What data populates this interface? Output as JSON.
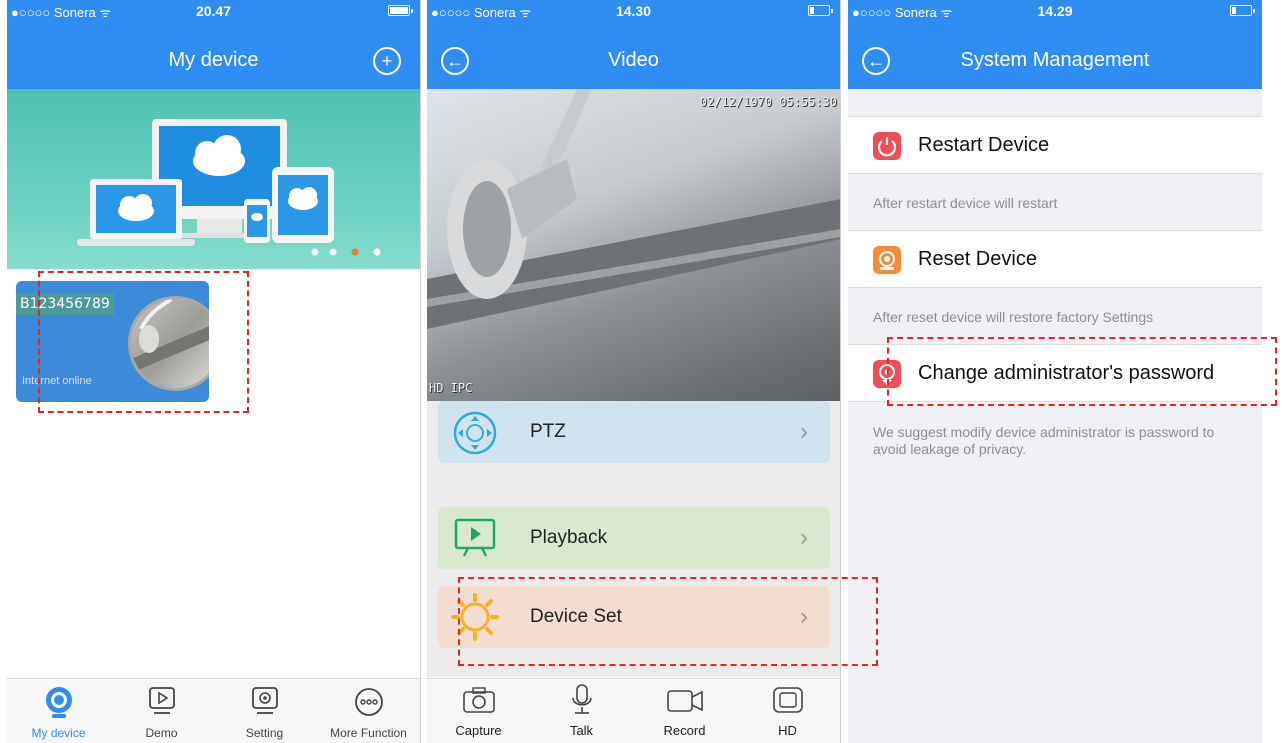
{
  "status_bars": [
    {
      "carrier": "●○○○○ Sonera ᯤ",
      "time": "20.47",
      "battery_level": 1.0
    },
    {
      "carrier": "●○○○○ Sonera ᯤ",
      "time": "14.30",
      "battery_level": 0.2
    },
    {
      "carrier": "●○○○○ Sonera ᯤ",
      "time": "14.29",
      "battery_level": 0.2
    }
  ],
  "my_device": {
    "title": "My device",
    "add_icon": "plus-circle-icon",
    "carousel": {
      "pages": 4,
      "active_page": 3
    },
    "device": {
      "id": "B123456789",
      "status": "Internet online"
    },
    "tabs": [
      {
        "label": "My device",
        "icon": "webcam-icon",
        "active": true
      },
      {
        "label": "Demo",
        "icon": "play-screen-icon",
        "active": false
      },
      {
        "label": "Setting",
        "icon": "gear-screen-icon",
        "active": false
      },
      {
        "label": "More Function",
        "icon": "more-icon",
        "active": false
      }
    ]
  },
  "video": {
    "title": "Video",
    "back_icon": "back-arrow-icon",
    "timestamp": "02/12/1970 05:55:30",
    "camera_label": "HD IPC",
    "menu": [
      {
        "label": "PTZ",
        "icon": "joystick-icon",
        "color": "#cfe4ee"
      },
      {
        "label": "Playback",
        "icon": "playback-monitor-icon",
        "color": "#d9e9cf"
      },
      {
        "label": "Device Set",
        "icon": "sun-gear-icon",
        "color": "#f3ddd0"
      }
    ],
    "toolbar": [
      {
        "label": "Capture",
        "icon": "camera-icon"
      },
      {
        "label": "Talk",
        "icon": "microphone-icon"
      },
      {
        "label": "Record",
        "icon": "video-camera-icon"
      },
      {
        "label": "HD",
        "icon": "hd-screen-icon"
      }
    ]
  },
  "system": {
    "title": "System Management",
    "back_icon": "back-arrow-icon",
    "rows": [
      {
        "label": "Restart Device",
        "icon": "restart-icon",
        "color": "#ef4d57",
        "hint": "After restart device will restart"
      },
      {
        "label": "Reset Device",
        "icon": "reset-icon",
        "color": "#f58a3b",
        "hint": "After reset device will restore factory Settings"
      },
      {
        "label": "Change administrator's password",
        "icon": "password-icon",
        "color": "#ef4d57",
        "hint": "We suggest modify device administrator is password to avoid leakage of  privacy."
      }
    ]
  },
  "colors": {
    "brand": "#2f8df2",
    "highlight": "#e52525"
  }
}
